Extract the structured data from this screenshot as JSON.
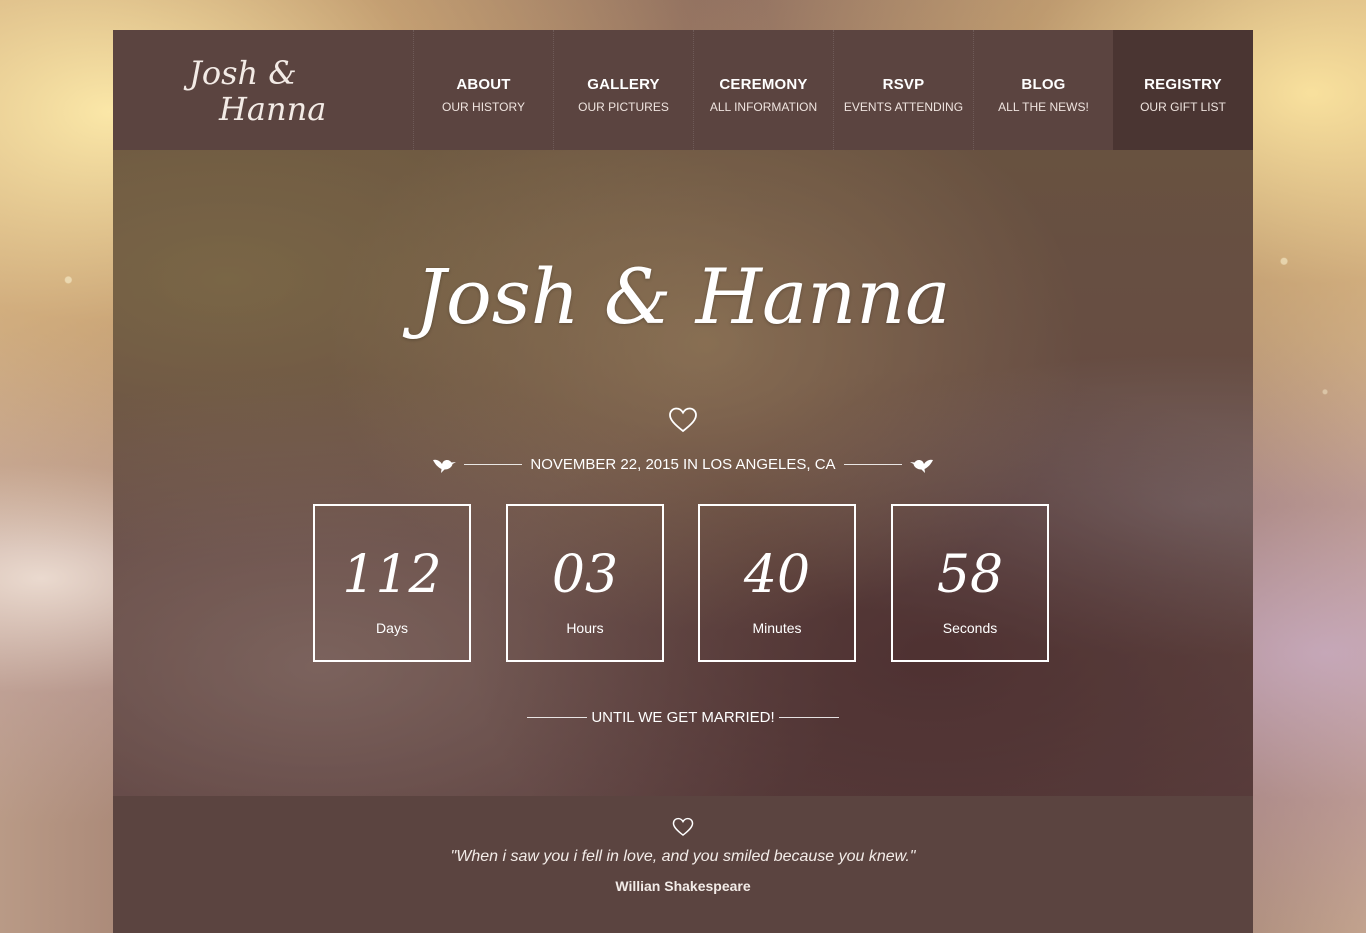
{
  "logo": {
    "line1": "Josh &",
    "line2": "Hanna"
  },
  "nav": {
    "items": [
      {
        "title": "ABOUT",
        "subtitle": "OUR HISTORY"
      },
      {
        "title": "GALLERY",
        "subtitle": "OUR PICTURES"
      },
      {
        "title": "CEREMONY",
        "subtitle": "ALL INFORMATION"
      },
      {
        "title": "RSVP",
        "subtitle": "EVENTS ATTENDING"
      },
      {
        "title": "BLOG",
        "subtitle": "ALL THE NEWS!"
      },
      {
        "title": "REGISTRY",
        "subtitle": "OUR GIFT LIST"
      }
    ],
    "active": "REGISTRY"
  },
  "hero": {
    "title": "Josh & Hanna",
    "date_location": "NOVEMBER 22, 2015 IN LOS ANGELES, CA",
    "tagline": "UNTIL WE GET MARRIED!"
  },
  "countdown": [
    {
      "value": "112",
      "label": "Days"
    },
    {
      "value": "03",
      "label": "Hours"
    },
    {
      "value": "40",
      "label": "Minutes"
    },
    {
      "value": "58",
      "label": "Seconds"
    }
  ],
  "quote": {
    "text": "\"When i saw you i fell in love, and you smiled because you knew.\"",
    "author": "Willian Shakespeare"
  },
  "icons": {
    "hero_heart": "heart-outline-icon",
    "left_bird": "bird-icon",
    "right_bird": "bird-icon",
    "quote_heart": "heart-outline-icon"
  },
  "colors": {
    "header_bg": "#5b4440",
    "active_nav_bg": "#4a3532",
    "text": "#ffffff"
  }
}
